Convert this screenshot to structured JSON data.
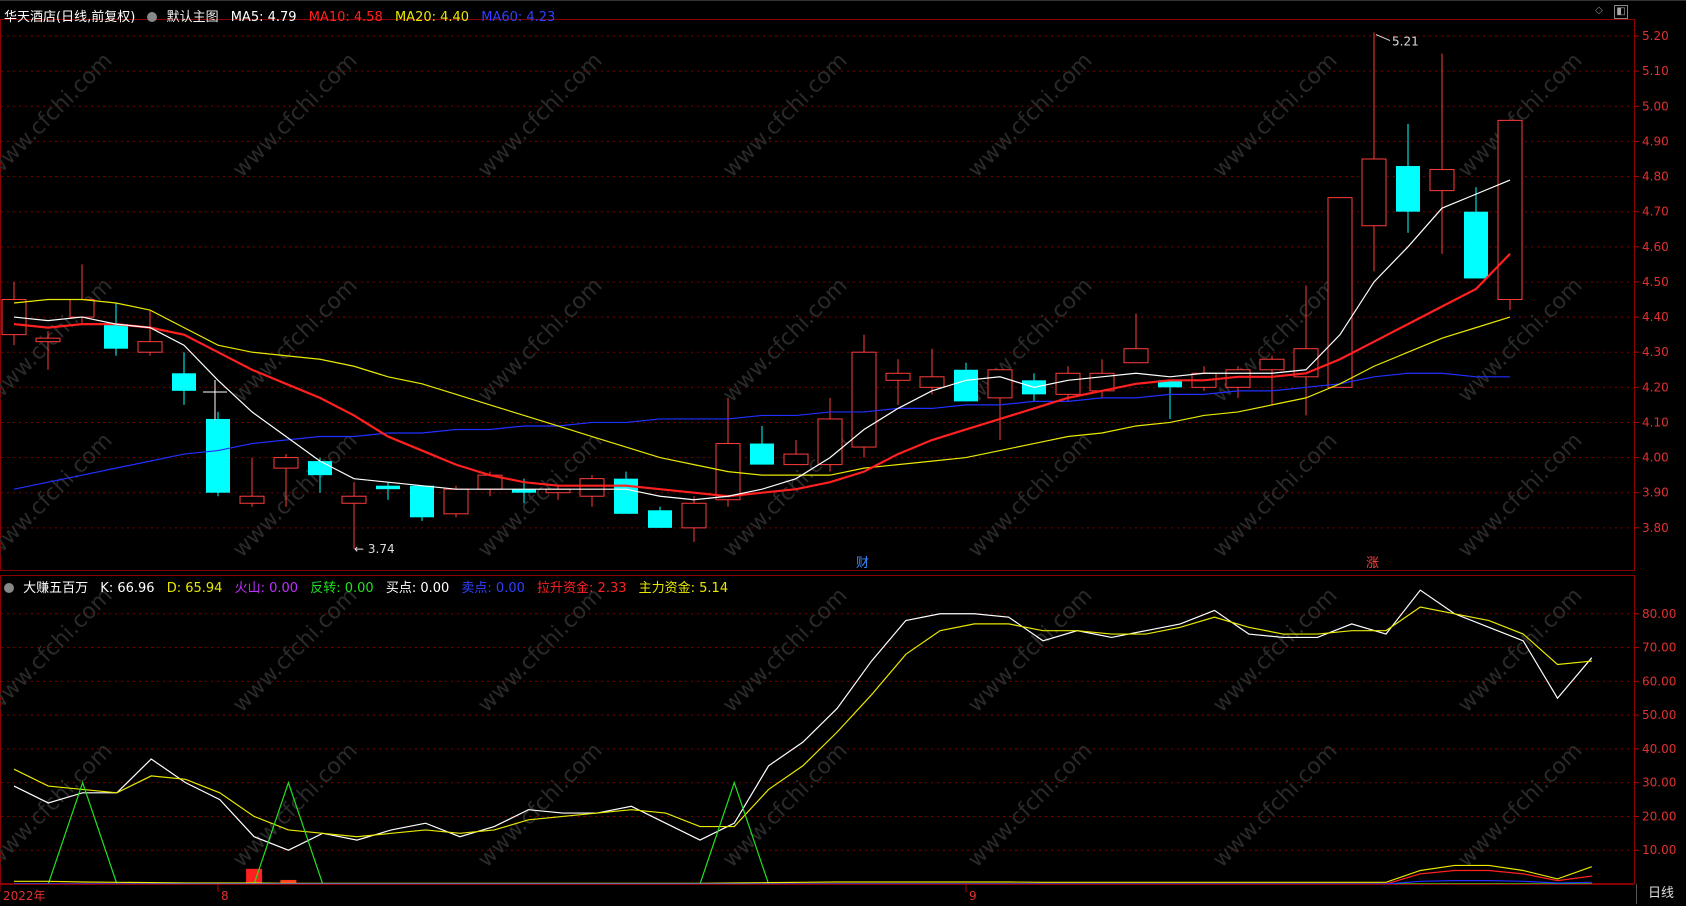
{
  "window": {
    "daily_button": "日线"
  },
  "main_panel": {
    "title": "华天酒店(日线,前复权)",
    "indicator_name": "默认主图",
    "ma": [
      {
        "label": "MA5: 4.79",
        "color": "#ffffff"
      },
      {
        "label": "MA10: 4.58",
        "color": "#ff2020"
      },
      {
        "label": "MA20: 4.40",
        "color": "#e8e800"
      },
      {
        "label": "MA60: 4.23",
        "color": "#2030ff"
      }
    ],
    "high_label": "5.21",
    "low_label": "3.74",
    "event_labels": [
      {
        "text": "财",
        "color": "#3c8cff",
        "index": 24
      },
      {
        "text": "涨",
        "color": "#ff4040",
        "index": 39
      }
    ]
  },
  "sub_panel": {
    "name": "大赚五百万",
    "items": [
      {
        "label": "K: 66.96",
        "color": "#ffffff"
      },
      {
        "label": "D: 65.94",
        "color": "#e8e800"
      },
      {
        "label": "火山: 0.00",
        "color": "#c030ff"
      },
      {
        "label": "反转: 0.00",
        "color": "#20e020"
      },
      {
        "label": "买点: 0.00",
        "color": "#ffffff"
      },
      {
        "label": "卖点: 0.00",
        "color": "#2030ff"
      },
      {
        "label": "拉升资金: 2.33",
        "color": "#ff2020"
      },
      {
        "label": "主力资金: 5.14",
        "color": "#e8e800"
      }
    ]
  },
  "x_axis": {
    "labels": [
      {
        "text": "2022年",
        "index": 0
      },
      {
        "text": "8",
        "index": 6
      },
      {
        "text": "9",
        "index": 28
      }
    ]
  },
  "watermark": "www.cfchi.com",
  "chart_data": [
    {
      "type": "candlestick",
      "title": "华天酒店(日线,前复权)",
      "ylim": [
        3.68,
        5.24
      ],
      "y_ticks": [
        "5.20",
        "5.10",
        "5.00",
        "4.90",
        "4.80",
        "4.70",
        "4.60",
        "4.50",
        "4.40",
        "4.30",
        "4.20",
        "4.10",
        "4.00",
        "3.90",
        "3.80"
      ],
      "candles": [
        {
          "o": 4.35,
          "h": 4.5,
          "l": 4.32,
          "c": 4.45
        },
        {
          "o": 4.33,
          "h": 4.36,
          "l": 4.25,
          "c": 4.34
        },
        {
          "o": 4.4,
          "h": 4.55,
          "l": 4.38,
          "c": 4.45
        },
        {
          "o": 4.38,
          "h": 4.44,
          "l": 4.29,
          "c": 4.31
        },
        {
          "o": 4.3,
          "h": 4.42,
          "l": 4.29,
          "c": 4.33
        },
        {
          "o": 4.24,
          "h": 4.3,
          "l": 4.15,
          "c": 4.19
        },
        {
          "o": 4.11,
          "h": 4.13,
          "l": 3.89,
          "c": 3.9
        },
        {
          "o": 3.87,
          "h": 4.0,
          "l": 3.86,
          "c": 3.89
        },
        {
          "o": 3.97,
          "h": 4.01,
          "l": 3.86,
          "c": 4.0
        },
        {
          "o": 3.99,
          "h": 4.0,
          "l": 3.9,
          "c": 3.95
        },
        {
          "o": 3.87,
          "h": 3.93,
          "l": 3.74,
          "c": 3.89
        },
        {
          "o": 3.92,
          "h": 3.93,
          "l": 3.88,
          "c": 3.91
        },
        {
          "o": 3.92,
          "h": 3.92,
          "l": 3.82,
          "c": 3.83
        },
        {
          "o": 3.84,
          "h": 3.92,
          "l": 3.83,
          "c": 3.91
        },
        {
          "o": 3.91,
          "h": 3.96,
          "l": 3.89,
          "c": 3.95
        },
        {
          "o": 3.91,
          "h": 3.94,
          "l": 3.87,
          "c": 3.9
        },
        {
          "o": 3.9,
          "h": 3.92,
          "l": 3.88,
          "c": 3.91
        },
        {
          "o": 3.89,
          "h": 3.95,
          "l": 3.86,
          "c": 3.94
        },
        {
          "o": 3.94,
          "h": 3.96,
          "l": 3.84,
          "c": 3.84
        },
        {
          "o": 3.85,
          "h": 3.86,
          "l": 3.8,
          "c": 3.8
        },
        {
          "o": 3.8,
          "h": 3.89,
          "l": 3.76,
          "c": 3.87
        },
        {
          "o": 3.88,
          "h": 4.17,
          "l": 3.86,
          "c": 4.04
        },
        {
          "o": 4.04,
          "h": 4.09,
          "l": 3.98,
          "c": 3.98
        },
        {
          "o": 3.98,
          "h": 4.05,
          "l": 3.98,
          "c": 4.01
        },
        {
          "o": 3.98,
          "h": 4.17,
          "l": 3.96,
          "c": 4.11
        },
        {
          "o": 4.03,
          "h": 4.35,
          "l": 4.0,
          "c": 4.3
        },
        {
          "o": 4.22,
          "h": 4.28,
          "l": 4.15,
          "c": 4.24
        },
        {
          "o": 4.2,
          "h": 4.31,
          "l": 4.18,
          "c": 4.23
        },
        {
          "o": 4.25,
          "h": 4.27,
          "l": 4.16,
          "c": 4.16
        },
        {
          "o": 4.17,
          "h": 4.25,
          "l": 4.05,
          "c": 4.25
        },
        {
          "o": 4.22,
          "h": 4.24,
          "l": 4.16,
          "c": 4.18
        },
        {
          "o": 4.18,
          "h": 4.26,
          "l": 4.16,
          "c": 4.24
        },
        {
          "o": 4.19,
          "h": 4.28,
          "l": 4.17,
          "c": 4.24
        },
        {
          "o": 4.27,
          "h": 4.41,
          "l": 4.27,
          "c": 4.31
        },
        {
          "o": 4.22,
          "h": 4.22,
          "l": 4.11,
          "c": 4.2
        },
        {
          "o": 4.2,
          "h": 4.26,
          "l": 4.19,
          "c": 4.24
        },
        {
          "o": 4.2,
          "h": 4.26,
          "l": 4.17,
          "c": 4.25
        },
        {
          "o": 4.25,
          "h": 4.29,
          "l": 4.15,
          "c": 4.28
        },
        {
          "o": 4.23,
          "h": 4.49,
          "l": 4.12,
          "c": 4.31
        },
        {
          "o": 4.2,
          "h": 4.74,
          "l": 4.2,
          "c": 4.74
        },
        {
          "o": 4.66,
          "h": 5.21,
          "l": 4.53,
          "c": 4.85
        },
        {
          "o": 4.83,
          "h": 4.95,
          "l": 4.64,
          "c": 4.7
        },
        {
          "o": 4.76,
          "h": 5.15,
          "l": 4.58,
          "c": 4.82
        },
        {
          "o": 4.7,
          "h": 4.77,
          "l": 4.51,
          "c": 4.51
        },
        {
          "o": 4.45,
          "h": 4.96,
          "l": 4.42,
          "c": 4.96
        }
      ],
      "series": [
        {
          "name": "MA5",
          "color": "#ffffff",
          "values": [
            4.4,
            4.39,
            4.4,
            4.38,
            4.37,
            4.32,
            4.22,
            4.13,
            4.06,
            3.99,
            3.94,
            3.93,
            3.92,
            3.91,
            3.91,
            3.91,
            3.91,
            3.91,
            3.91,
            3.89,
            3.88,
            3.89,
            3.91,
            3.94,
            4.0,
            4.08,
            4.14,
            4.19,
            4.22,
            4.23,
            4.2,
            4.22,
            4.23,
            4.24,
            4.23,
            4.24,
            4.24,
            4.24,
            4.25,
            4.35,
            4.5,
            4.6,
            4.71,
            4.75,
            4.79
          ]
        },
        {
          "name": "MA10",
          "color": "#ff2020",
          "values": [
            4.38,
            4.37,
            4.38,
            4.38,
            4.37,
            4.35,
            4.3,
            4.25,
            4.21,
            4.17,
            4.12,
            4.06,
            4.02,
            3.98,
            3.95,
            3.93,
            3.92,
            3.92,
            3.92,
            3.91,
            3.9,
            3.89,
            3.9,
            3.91,
            3.93,
            3.96,
            4.01,
            4.05,
            4.08,
            4.11,
            4.14,
            4.17,
            4.19,
            4.21,
            4.22,
            4.22,
            4.23,
            4.23,
            4.24,
            4.28,
            4.33,
            4.38,
            4.43,
            4.48,
            4.58
          ]
        },
        {
          "name": "MA20",
          "color": "#e8e800",
          "values": [
            4.44,
            4.45,
            4.45,
            4.44,
            4.42,
            4.37,
            4.32,
            4.3,
            4.29,
            4.28,
            4.26,
            4.23,
            4.21,
            4.18,
            4.15,
            4.12,
            4.09,
            4.06,
            4.03,
            4.0,
            3.98,
            3.96,
            3.95,
            3.95,
            3.95,
            3.97,
            3.98,
            3.99,
            4.0,
            4.02,
            4.04,
            4.06,
            4.07,
            4.09,
            4.1,
            4.12,
            4.13,
            4.15,
            4.17,
            4.21,
            4.26,
            4.3,
            4.34,
            4.37,
            4.4
          ]
        },
        {
          "name": "MA60",
          "color": "#2030ff",
          "values": [
            3.91,
            3.93,
            3.95,
            3.97,
            3.99,
            4.01,
            4.02,
            4.04,
            4.05,
            4.06,
            4.06,
            4.07,
            4.07,
            4.08,
            4.08,
            4.09,
            4.09,
            4.1,
            4.1,
            4.11,
            4.11,
            4.11,
            4.12,
            4.12,
            4.13,
            4.13,
            4.14,
            4.14,
            4.15,
            4.15,
            4.16,
            4.16,
            4.17,
            4.17,
            4.18,
            4.18,
            4.19,
            4.19,
            4.2,
            4.21,
            4.23,
            4.24,
            4.24,
            4.23,
            4.23
          ]
        }
      ]
    },
    {
      "type": "line",
      "title": "大赚五百万",
      "ylim": [
        0,
        90
      ],
      "y_ticks": [
        "80.00",
        "70.00",
        "60.00",
        "50.00",
        "40.00",
        "30.00",
        "20.00",
        "10.00"
      ],
      "series": [
        {
          "name": "K",
          "color": "#ffffff",
          "values": [
            29,
            24,
            27,
            27,
            37,
            30,
            25,
            14,
            10,
            15,
            13,
            16,
            18,
            14,
            17,
            22,
            21,
            21,
            23,
            18,
            13,
            18,
            35,
            42,
            52,
            66,
            78,
            80,
            80,
            79,
            72,
            75,
            73,
            75,
            77,
            81,
            74,
            73,
            73,
            77,
            74,
            87,
            80,
            76,
            72,
            55,
            67
          ]
        },
        {
          "name": "D",
          "color": "#e8e800",
          "values": [
            34,
            29,
            28,
            27,
            32,
            31,
            27,
            20,
            16,
            15,
            14,
            15,
            16,
            15,
            16,
            19,
            20,
            21,
            22,
            21,
            17,
            17,
            28,
            35,
            45,
            56,
            68,
            75,
            77,
            77,
            75,
            75,
            74,
            74,
            76,
            79,
            76,
            74,
            74,
            75,
            75,
            82,
            80,
            78,
            74,
            65,
            66
          ]
        },
        {
          "name": "反转",
          "color": "#20e020",
          "values": [
            0,
            0,
            30,
            0,
            0,
            0,
            0,
            0,
            30,
            0,
            0,
            0,
            0,
            0,
            0,
            0,
            0,
            0,
            0,
            0,
            0,
            30,
            0,
            0,
            0,
            0,
            0,
            0,
            0,
            0,
            0,
            0,
            0,
            0,
            0,
            0,
            0,
            0,
            0,
            0,
            0,
            0,
            0,
            0,
            0,
            0,
            0
          ]
        },
        {
          "name": "拉升资金",
          "color": "#ff2020",
          "values": [
            0,
            0,
            0,
            0,
            0,
            0,
            0,
            0,
            0,
            0,
            0,
            0,
            0,
            0,
            0,
            0,
            0,
            0,
            0,
            0,
            0,
            0,
            0,
            0,
            0,
            0,
            0,
            0,
            0,
            0,
            0,
            0,
            0,
            0,
            0,
            0,
            0,
            0,
            0,
            0,
            0,
            3,
            4,
            4,
            3,
            1,
            2.33
          ]
        },
        {
          "name": "主力资金",
          "color": "#e8e800",
          "values": [
            0.8,
            0.8,
            0.6,
            0.5,
            0.4,
            0.3,
            0.3,
            0.3,
            0.2,
            0.2,
            0.2,
            0.2,
            0.2,
            0.2,
            0.2,
            0.2,
            0.2,
            0.2,
            0.2,
            0.2,
            0.2,
            0.3,
            0.4,
            0.5,
            0.6,
            0.6,
            0.6,
            0.6,
            0.6,
            0.6,
            0.5,
            0.5,
            0.5,
            0.5,
            0.5,
            0.5,
            0.5,
            0.5,
            0.5,
            0.5,
            0.5,
            4,
            5.5,
            5.5,
            4,
            1.5,
            5.14
          ]
        },
        {
          "name": "卖点",
          "color": "#2030ff",
          "values": [
            0,
            0,
            0,
            0,
            0,
            0,
            0,
            0,
            0,
            0,
            0,
            0,
            0,
            0,
            0,
            0,
            0,
            0,
            0,
            0,
            0,
            0,
            0,
            0,
            0,
            0,
            0,
            0,
            0,
            0,
            0,
            0,
            0,
            0,
            0,
            0,
            0,
            0,
            0,
            0,
            0,
            0.8,
            1,
            1,
            0.8,
            0.3,
            0.5
          ]
        }
      ],
      "bars": [
        {
          "index": 7,
          "value": 4.5,
          "color": "#ff2020"
        },
        {
          "index": 8,
          "value": 1.2,
          "color": "#ff4020"
        }
      ]
    }
  ]
}
